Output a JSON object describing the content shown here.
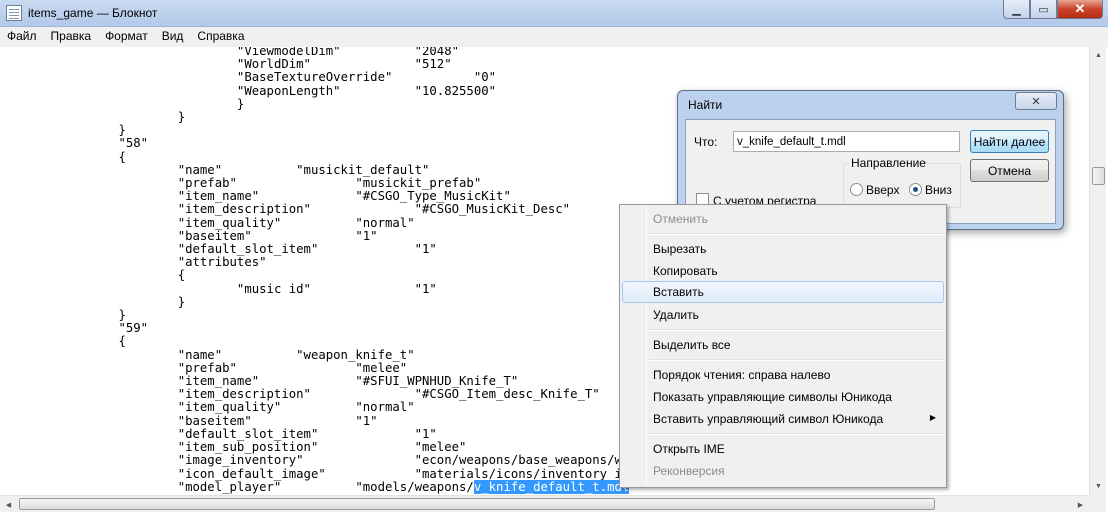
{
  "window": {
    "title": "items_game — Блокнот",
    "icon": "notepad-icon"
  },
  "controls": {
    "minimize": "▁",
    "maximize": "▭",
    "close": "✕"
  },
  "menu": [
    "Файл",
    "Правка",
    "Формат",
    "Вид",
    "Справка"
  ],
  "editor": {
    "lines": [
      "\t\t\t\t\"ViewmodelDim\"\t\t\"2048\"",
      "\t\t\t\t\"WorldDim\"\t\t\"512\"",
      "\t\t\t\t\"BaseTextureOverride\"\t\t\"0\"",
      "\t\t\t\t\"WeaponLength\"\t\t\"10.825500\"",
      "\t\t\t\t}",
      "\t\t\t}",
      "\t\t}",
      "\t\t\"58\"",
      "\t\t{",
      "\t\t\t\"name\"\t\t\"musickit_default\"",
      "\t\t\t\"prefab\"\t\t\"musickit_prefab\"",
      "\t\t\t\"item_name\"\t\t\"#CSGO_Type_MusicKit\"",
      "\t\t\t\"item_description\"\t\t\"#CSGO_MusicKit_Desc\"",
      "\t\t\t\"item_quality\"\t\t\"normal\"",
      "\t\t\t\"baseitem\"\t\t\"1\"",
      "\t\t\t\"default_slot_item\"\t\t\"1\"",
      "\t\t\t\"attributes\"",
      "\t\t\t{",
      "\t\t\t\t\"music id\"\t\t\"1\"",
      "\t\t\t}",
      "\t\t}",
      "\t\t\"59\"",
      "\t\t{",
      "\t\t\t\"name\"\t\t\"weapon_knife_t\"",
      "\t\t\t\"prefab\"\t\t\"melee\"",
      "\t\t\t\"item_name\"\t\t\"#SFUI_WPNHUD_Knife_T\"",
      "\t\t\t\"item_description\"\t\t\"#CSGO_Item_desc_Knife_T\"",
      "\t\t\t\"item_quality\"\t\t\"normal\"",
      "\t\t\t\"baseitem\"\t\t\"1\"",
      "\t\t\t\"default_slot_item\"\t\t\"1\"",
      "\t\t\t\"item_sub_position\"\t\t\"melee\"",
      "\t\t\t\"image_inventory\"\t\t\"econ/weapons/base_weapons/weapon_knife_t\"",
      "\t\t\t\"icon_default_image\"\t\t\"materials/icons/inventory_icon_weapon_knife_t.vtf\"",
      "\t\t\t\"model_player\"\t\t\"models/weapons/"
    ],
    "last_line_selected": "v_knife_default_t.mdl",
    "last_line_tail": "\""
  },
  "find_dialog": {
    "title": "Найти",
    "close": "✕",
    "what_label": "Что:",
    "what_value": "v_knife_default_t.mdl",
    "find_next": "Найти далее",
    "cancel": "Отмена",
    "direction_label": "Направление",
    "up_label": "Вверх",
    "down_label": "Вниз",
    "match_case_label": "С учетом регистра"
  },
  "context_menu": {
    "undo": "Отменить",
    "cut": "Вырезать",
    "copy": "Копировать",
    "paste": "Вставить",
    "delete": "Удалить",
    "select_all": "Выделить все",
    "rtl": "Порядок чтения: справа налево",
    "show_unicode": "Показать управляющие символы Юникода",
    "insert_unicode": "Вставить управляющий символ Юникода",
    "open_ime": "Открыть IME",
    "reconversion": "Реконверсия"
  },
  "scrollbar": {
    "up": "▲",
    "down": "▼",
    "left": "◀",
    "right": "▶"
  },
  "submenu_arrow": "▶"
}
